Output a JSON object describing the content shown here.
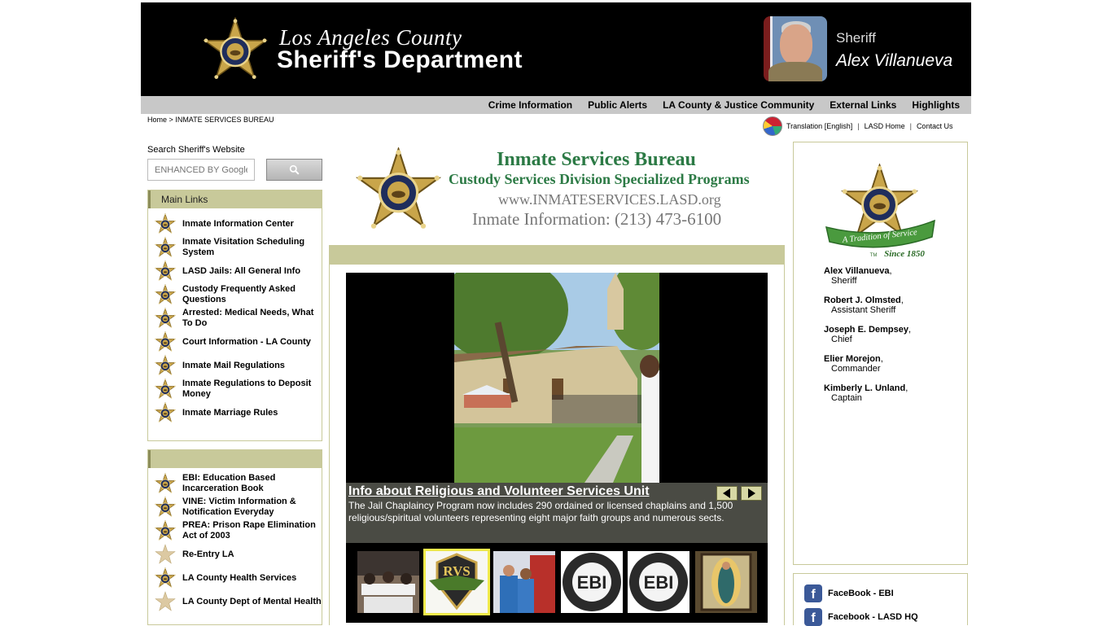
{
  "header": {
    "county": "Los Angeles County",
    "department": "Sheriff's Department",
    "sheriff_label": "Sheriff",
    "sheriff_name": "Alex Villanueva"
  },
  "topnav": {
    "items": [
      {
        "label": "Crime Information"
      },
      {
        "label": "Public Alerts"
      },
      {
        "label": "LA County & Justice Community"
      },
      {
        "label": "External Links"
      },
      {
        "label": "Highlights"
      }
    ]
  },
  "breadcrumb": {
    "home": "Home",
    "separator": ">",
    "current": "INMATE SERVICES BUREAU"
  },
  "utility": {
    "translation": "Translation [English]",
    "lasd_home": "LASD Home",
    "contact": "Contact Us",
    "separator": "|"
  },
  "search": {
    "label": "Search Sheriff's Website",
    "placeholder": "ENHANCED BY Google"
  },
  "main_links": {
    "title": "Main Links",
    "items": [
      {
        "label": "Inmate Information Center"
      },
      {
        "label": "Inmate Visitation Scheduling System"
      },
      {
        "label": "LASD Jails: All General Info"
      },
      {
        "label": "Custody Frequently Asked Questions"
      },
      {
        "label": "Arrested: Medical Needs, What To Do"
      },
      {
        "label": "Court Information - LA County"
      },
      {
        "label": "Inmate Mail Regulations"
      },
      {
        "label": "Inmate Regulations to Deposit Money"
      },
      {
        "label": "Inmate Marriage Rules"
      }
    ]
  },
  "more_links": {
    "items": [
      {
        "label": "EBI: Education Based Incarceration Book"
      },
      {
        "label": "VINE: Victim Information & Notification Everyday"
      },
      {
        "label": "PREA: Prison Rape Elimination Act of 2003"
      },
      {
        "label": "Re-Entry LA"
      },
      {
        "label": "LA County Health Services"
      },
      {
        "label": "LA County Dept of Mental Health"
      }
    ]
  },
  "isb": {
    "title": "Inmate Services Bureau",
    "subtitle": "Custody Services Division Specialized Programs",
    "url": "www.INMATESERVICES.LASD.org",
    "phone": "Inmate Information: (213) 473-6100"
  },
  "slideshow": {
    "title": "Info about Religious and Volunteer Services Unit",
    "text": "The Jail Chaplaincy Program now includes 290 ordained or licensed chaplains and 1,500 religious/spiritual volunteers representing eight major faith groups and numerous sects.",
    "thumbs": [
      {
        "icon": "classroom-photo"
      },
      {
        "icon": "rvs-badge",
        "text": "RVS",
        "selected": true
      },
      {
        "icon": "inmates-photo"
      },
      {
        "icon": "ebi-seal",
        "text": "EBI"
      },
      {
        "icon": "ebi-seal",
        "text": "EBI"
      },
      {
        "icon": "guadalupe-painting"
      }
    ]
  },
  "leaders": [
    {
      "name": "Alex Villanueva",
      "title": "Sheriff"
    },
    {
      "name": "Robert J. Olmsted",
      "title": "Assistant Sheriff"
    },
    {
      "name": "Joseph E. Dempsey",
      "title": "Chief"
    },
    {
      "name": "Elier Morejon",
      "title": "Commander"
    },
    {
      "name": "Kimberly L. Unland",
      "title": "Captain"
    }
  ],
  "tradition": {
    "text": "A Tradition of Service",
    "since": "Since 1850",
    "tm": "TM"
  },
  "social": [
    {
      "label": "FaceBook - EBI"
    },
    {
      "label": "Facebook - LASD HQ"
    }
  ],
  "colors": {
    "olive": "#c8c99a",
    "link_green": "#2c7a45",
    "banner": "#000000"
  }
}
